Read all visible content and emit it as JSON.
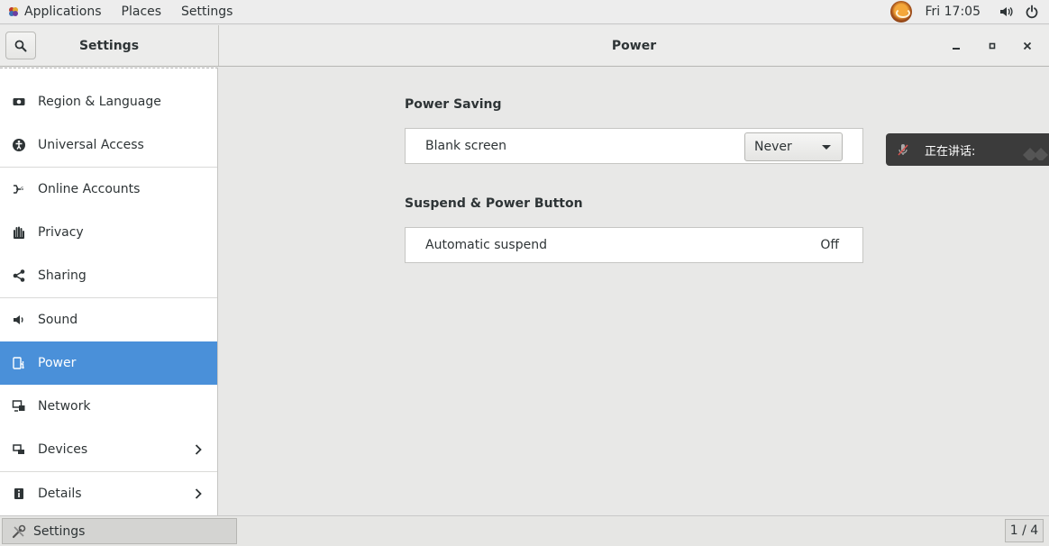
{
  "topbar": {
    "menus": [
      "Applications",
      "Places",
      "Settings"
    ],
    "clock": "Fri 17:05",
    "icons": [
      "applications-logo-icon",
      "user-avatar-icon",
      "volume-icon",
      "power-icon"
    ]
  },
  "header": {
    "sidebar_title": "Settings",
    "page_title": "Power",
    "controls": [
      "minimize-icon",
      "maximize-icon",
      "close-icon"
    ]
  },
  "sidebar": {
    "items": [
      {
        "label": "Region & Language",
        "icon": "region-icon",
        "active": false,
        "chevron": false
      },
      {
        "label": "Universal Access",
        "icon": "accessibility-icon",
        "active": false,
        "chevron": false
      },
      {
        "label": "Online Accounts",
        "icon": "online-accounts-icon",
        "active": false,
        "chevron": false
      },
      {
        "label": "Privacy",
        "icon": "privacy-hand-icon",
        "active": false,
        "chevron": false
      },
      {
        "label": "Sharing",
        "icon": "share-icon",
        "active": false,
        "chevron": false
      },
      {
        "label": "Sound",
        "icon": "sound-icon",
        "active": false,
        "chevron": false
      },
      {
        "label": "Power",
        "icon": "power-settings-icon",
        "active": true,
        "chevron": false
      },
      {
        "label": "Network",
        "icon": "network-icon",
        "active": false,
        "chevron": false
      },
      {
        "label": "Devices",
        "icon": "devices-icon",
        "active": false,
        "chevron": true
      },
      {
        "label": "Details",
        "icon": "info-icon",
        "active": false,
        "chevron": true
      }
    ]
  },
  "main": {
    "power_saving": {
      "title": "Power Saving",
      "blank_screen_label": "Blank screen",
      "blank_screen_value": "Never"
    },
    "suspend": {
      "title": "Suspend & Power Button",
      "automatic_suspend_label": "Automatic suspend",
      "automatic_suspend_value": "Off"
    }
  },
  "overlay": {
    "text": "正在讲话:"
  },
  "taskbar": {
    "window_label": "Settings",
    "workspace": "1 / 4"
  },
  "colors": {
    "accent": "#4a90d9",
    "background": "#e8e8e7",
    "overlay": "#3b3b3b"
  }
}
